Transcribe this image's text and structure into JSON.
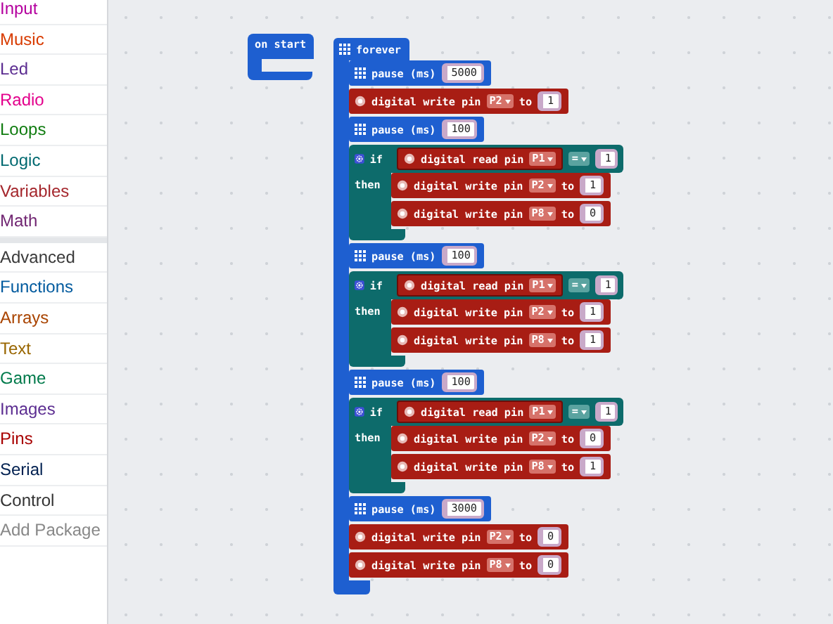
{
  "sidebar": {
    "items": [
      {
        "label": "Input",
        "color": "#b4009e"
      },
      {
        "label": "Music",
        "color": "#d83b01"
      },
      {
        "label": "Led",
        "color": "#5c2d91"
      },
      {
        "label": "Radio",
        "color": "#e3008c"
      },
      {
        "label": "Loops",
        "color": "#107c10"
      },
      {
        "label": "Logic",
        "color": "#006970"
      },
      {
        "label": "Variables",
        "color": "#a4262c"
      },
      {
        "label": "Math",
        "color": "#712672"
      },
      {
        "label": "Advanced",
        "color": "#3a3a3a",
        "divider": true
      },
      {
        "label": "Functions",
        "color": "#005a9e"
      },
      {
        "label": "Arrays",
        "color": "#a94400"
      },
      {
        "label": "Text",
        "color": "#996600"
      },
      {
        "label": "Game",
        "color": "#007a4b"
      },
      {
        "label": "Images",
        "color": "#5c2d91"
      },
      {
        "label": "Pins",
        "color": "#a80000"
      },
      {
        "label": "Serial",
        "color": "#002050"
      },
      {
        "label": "Control",
        "color": "#333333"
      },
      {
        "label": "Add Package",
        "color": "#888888"
      }
    ]
  },
  "on_start": {
    "label": "on start"
  },
  "forever": {
    "label": "forever",
    "statements": [
      {
        "kind": "pause",
        "label": "pause (ms)",
        "value": "5000"
      },
      {
        "kind": "write",
        "label": "digital write pin",
        "pin": "P2",
        "to": "to",
        "value": "1"
      },
      {
        "kind": "pause",
        "label": "pause (ms)",
        "value": "100"
      },
      {
        "kind": "if",
        "label": "if",
        "then": "then",
        "condition": {
          "label": "digital read pin",
          "pin": "P1",
          "op": "=",
          "value": "1"
        },
        "statements": [
          {
            "kind": "write",
            "label": "digital write pin",
            "pin": "P2",
            "to": "to",
            "value": "1"
          },
          {
            "kind": "write",
            "label": "digital write pin",
            "pin": "P8",
            "to": "to",
            "value": "0"
          }
        ]
      },
      {
        "kind": "pause",
        "label": "pause (ms)",
        "value": "100"
      },
      {
        "kind": "if",
        "label": "if",
        "then": "then",
        "condition": {
          "label": "digital read pin",
          "pin": "P1",
          "op": "=",
          "value": "1"
        },
        "statements": [
          {
            "kind": "write",
            "label": "digital write pin",
            "pin": "P2",
            "to": "to",
            "value": "1"
          },
          {
            "kind": "write",
            "label": "digital write pin",
            "pin": "P8",
            "to": "to",
            "value": "1"
          }
        ]
      },
      {
        "kind": "pause",
        "label": "pause (ms)",
        "value": "100"
      },
      {
        "kind": "if",
        "label": "if",
        "then": "then",
        "condition": {
          "label": "digital read pin",
          "pin": "P1",
          "op": "=",
          "value": "1"
        },
        "statements": [
          {
            "kind": "write",
            "label": "digital write pin",
            "pin": "P2",
            "to": "to",
            "value": "0"
          },
          {
            "kind": "write",
            "label": "digital write pin",
            "pin": "P8",
            "to": "to",
            "value": "1"
          }
        ]
      },
      {
        "kind": "pause",
        "label": "pause (ms)",
        "value": "3000"
      },
      {
        "kind": "write",
        "label": "digital write pin",
        "pin": "P2",
        "to": "to",
        "value": "0"
      },
      {
        "kind": "write",
        "label": "digital write pin",
        "pin": "P8",
        "to": "to",
        "value": "0"
      }
    ]
  }
}
